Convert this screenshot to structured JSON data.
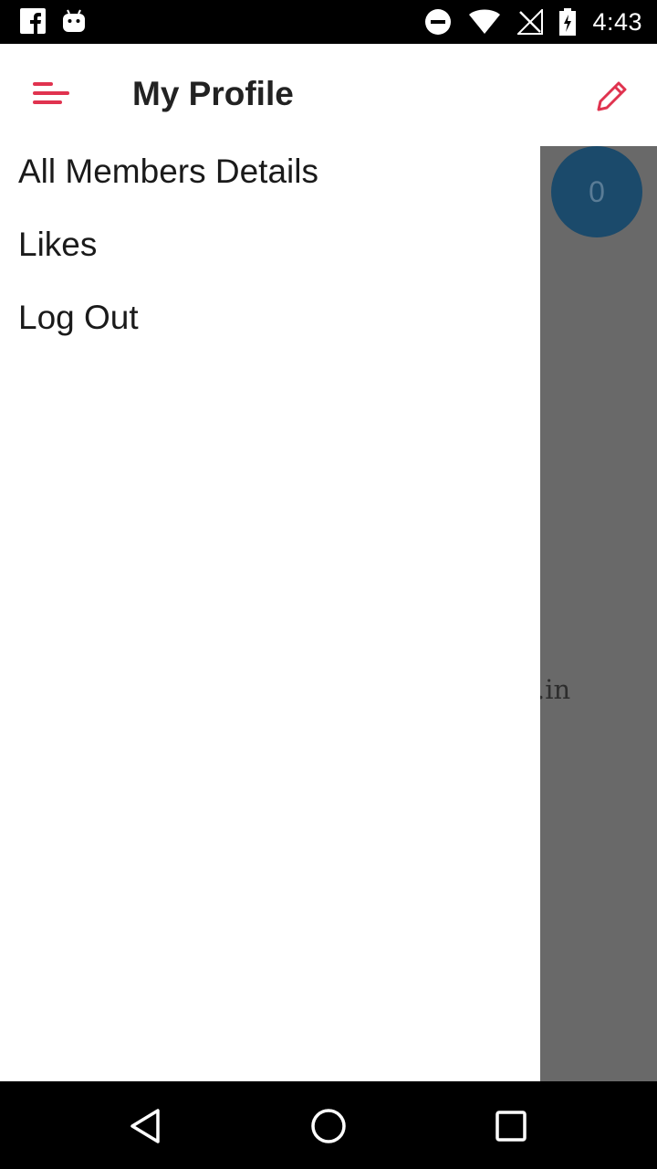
{
  "status_bar": {
    "time": "4:43",
    "left_icons": [
      "facebook-icon",
      "android-debug-icon"
    ],
    "right_icons": [
      "do-not-disturb-icon",
      "wifi-icon",
      "no-signal-icon",
      "battery-icon"
    ]
  },
  "app_bar": {
    "title": "My Profile",
    "accent_color": "#e0334f",
    "menu_icon": "menu-icon",
    "edit_icon": "pencil-icon"
  },
  "drawer": {
    "items": [
      {
        "label": "All Members Details"
      },
      {
        "label": "Likes"
      },
      {
        "label": "Log Out"
      }
    ]
  },
  "background": {
    "badge_count": "0",
    "partial_text": ".in"
  },
  "nav_bar": {
    "icons": [
      "back-icon",
      "home-icon",
      "recents-icon"
    ]
  }
}
